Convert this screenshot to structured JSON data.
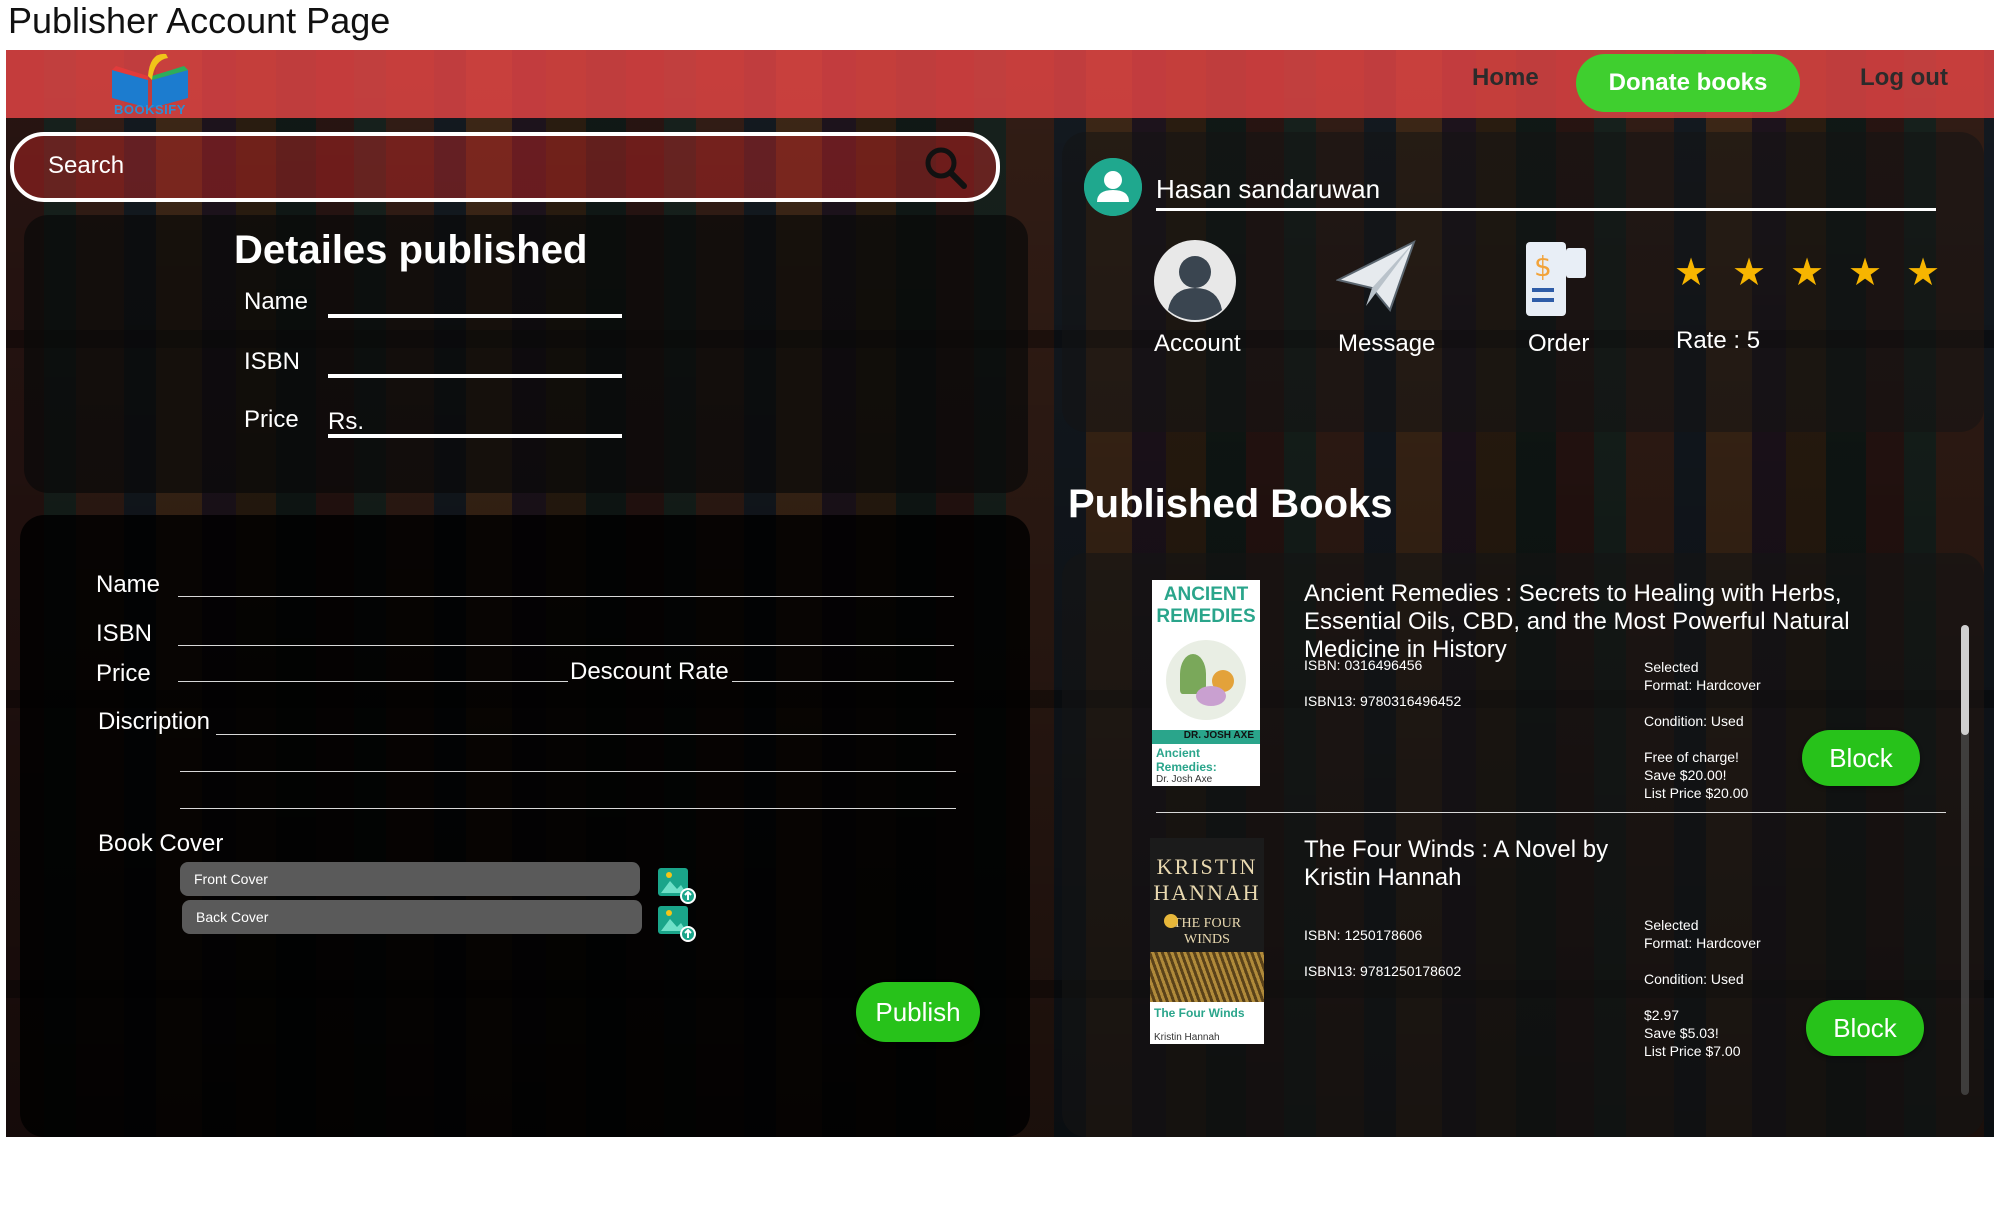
{
  "page_title": "Publisher Account Page",
  "header": {
    "logo_text": "BOOKSIFY",
    "nav": {
      "home": "Home",
      "donate": "Donate books",
      "logout": "Log out"
    }
  },
  "search": {
    "placeholder": "Search"
  },
  "details": {
    "title": "Detailes published",
    "name_label": "Name",
    "isbn_label": "ISBN",
    "price_label": "Price",
    "price_prefix": "Rs."
  },
  "form": {
    "name_label": "Name",
    "isbn_label": "ISBN",
    "price_label": "Price",
    "discount_label": "Descount Rate",
    "description_label": "Discription",
    "book_cover_label": "Book Cover",
    "front_cover": "Front Cover",
    "back_cover": "Back Cover",
    "publish_button": "Publish"
  },
  "profile": {
    "user_name": "Hasan sandaruwan",
    "actions": {
      "account": "Account",
      "message": "Message",
      "order": "Order"
    },
    "rating_stars": 5,
    "rate_text": "Rate : 5"
  },
  "published": {
    "title": "Published Books",
    "books": [
      {
        "title": "Ancient Remedies : Secrets to Healing with Herbs, Essential Oils, CBD, and the Most Powerful Natural Medicine in History",
        "isbn": "ISBN: 0316496456",
        "isbn13": "ISBN13: 9780316496452",
        "selected": "Selected",
        "format": "Format: Hardcover",
        "condition": "Condition: Used",
        "price": "Free of charge!",
        "save": "Save $20.00!",
        "list_price": "List Price $20.00",
        "cover_title": "ANCIENT REMEDIES",
        "cover_author": "DR. JOSH AXE",
        "cover_sub": "Ancient Remedies:",
        "cover_sub2": "Dr. Josh Axe",
        "block_button": "Block"
      },
      {
        "title": "The Four Winds : A Novel by Kristin Hannah",
        "isbn": "ISBN: 1250178606",
        "isbn13": "ISBN13: 9781250178602",
        "selected": "Selected",
        "format": "Format: Hardcover",
        "condition": "Condition: Used",
        "price": "$2.97",
        "save": "Save $5.03!",
        "list_price": "List Price $7.00",
        "cover_author": "KRISTIN HANNAH",
        "cover_title": "THE FOUR WINDS",
        "cover_sub": "The Four Winds",
        "cover_sub2": "Kristin Hannah",
        "block_button": "Block"
      }
    ]
  },
  "colors": {
    "header": "#e64646",
    "accent_green": "#27c21a",
    "star": "#f7b500"
  }
}
